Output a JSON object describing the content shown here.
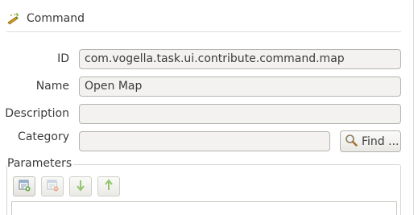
{
  "header": {
    "title": "Command",
    "icon": "command-wand-icon"
  },
  "form": {
    "id": {
      "label": "ID",
      "value": "com.vogella.task.ui.contribute.command.map"
    },
    "name": {
      "label": "Name",
      "value": "Open Map"
    },
    "description": {
      "label": "Description",
      "value": ""
    },
    "category": {
      "label": "Category",
      "value": "",
      "find_label": "Find ..."
    }
  },
  "parameters": {
    "title": "Parameters",
    "toolbar": [
      "add-parameter-icon",
      "remove-parameter-icon",
      "move-down-icon",
      "move-up-icon"
    ]
  },
  "colors": {
    "field_bg": "#f3f2f0",
    "field_border": "#b4b4ad",
    "arrow_green": "#6db33f"
  }
}
